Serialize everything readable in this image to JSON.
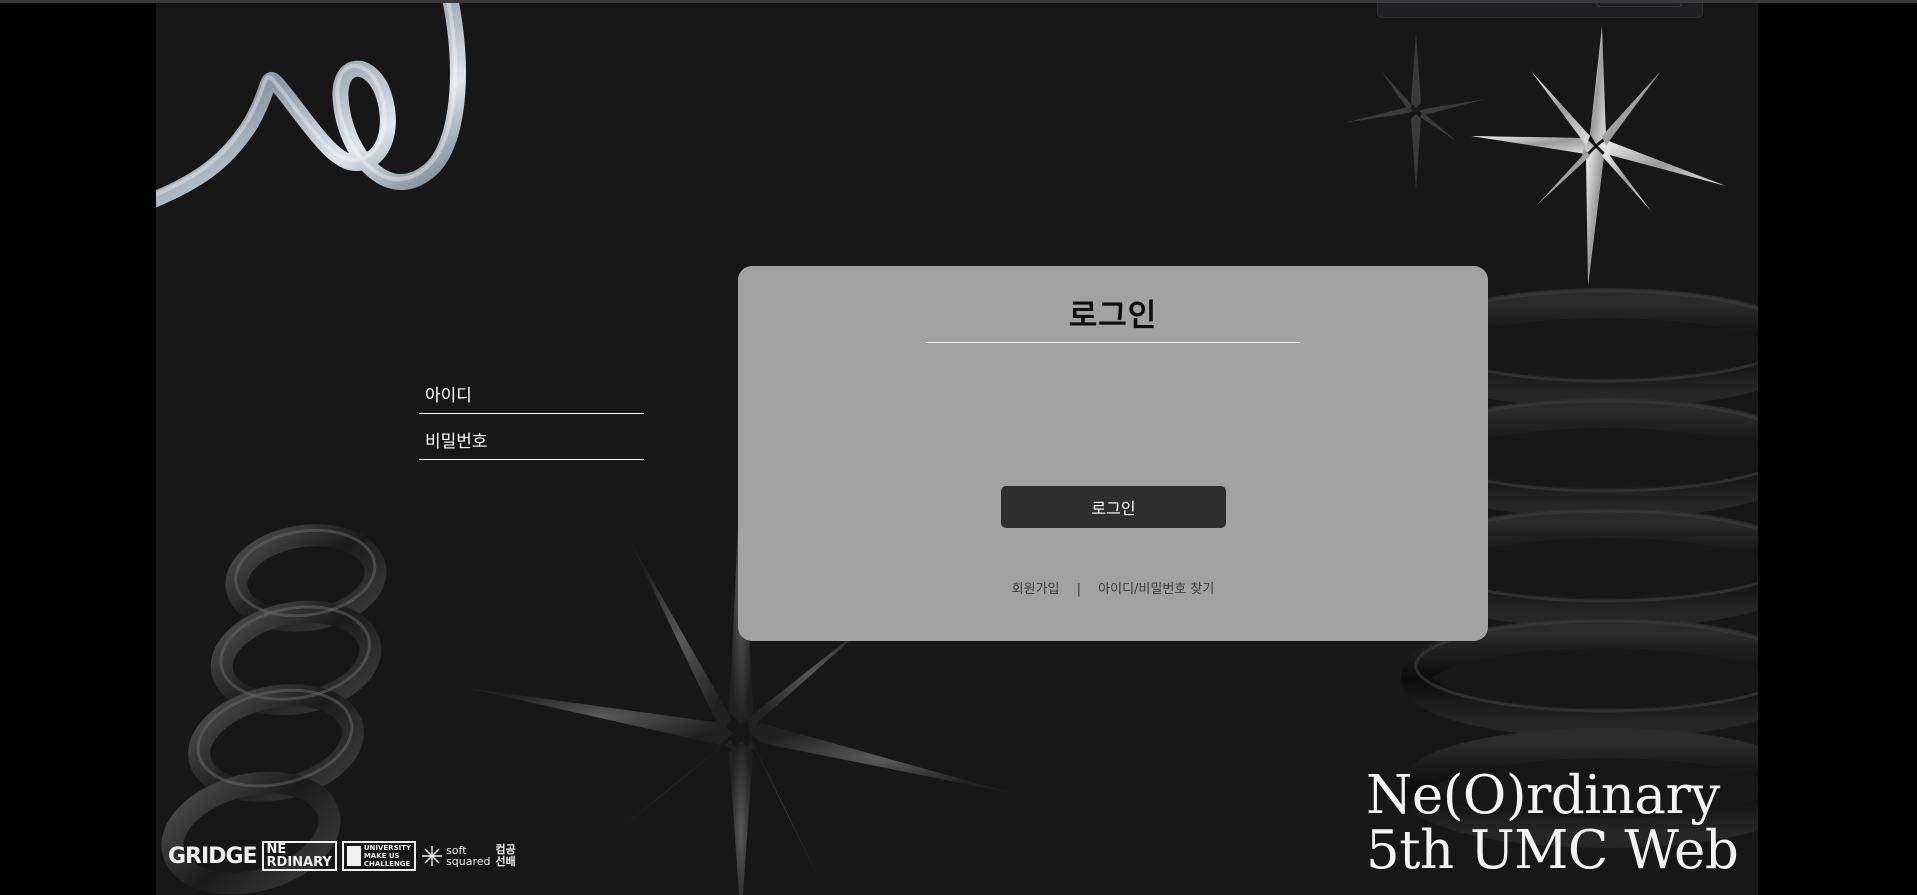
{
  "login": {
    "title": "로그인",
    "id_placeholder": "아이디",
    "pw_placeholder": "비밀번호",
    "submit_label": "로그인",
    "links": {
      "signup": "회원가입",
      "separator": "|",
      "find": "아이디/비밀번호 찾기"
    }
  },
  "brand": {
    "line1": "Ne(O)rdinary",
    "line2": "5th UMC Web"
  },
  "sponsor_logos": {
    "gridge": "GRIDGE",
    "neordinary_top": "NE",
    "neordinary_bottom": "RDINARY",
    "umc": [
      "UNIVERSITY",
      "MAKE US",
      "CHALLENGE"
    ],
    "softsquared": [
      "soft",
      "squared"
    ],
    "kk": [
      "컴공",
      "선배"
    ]
  },
  "colors": {
    "page_bg": "#171717",
    "card_bg": "#a2a2a2",
    "button_bg": "#2e2e2e",
    "text_light": "#ffffff"
  }
}
